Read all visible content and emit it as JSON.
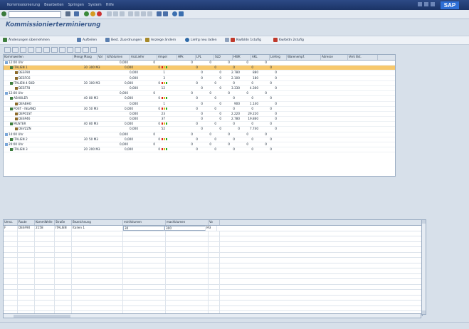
{
  "menu": [
    "Kommissionierung",
    "Bearbeiten",
    "Springen",
    "System",
    "Hilfe"
  ],
  "logo": "SAP",
  "title": "Kommissionierterminierung",
  "toolbar": [
    {
      "label": "Änderungen übernehmen",
      "color": "#3d7d3d"
    },
    {
      "label": "Aufteilen",
      "color": "#5a7fb0"
    },
    {
      "label": "Best. Zuordnungen",
      "color": "#5a7fb0"
    },
    {
      "label": "Anzeige ändern",
      "color": "#a78a2a"
    },
    {
      "label": "Liefrg neu laden",
      "color": "#2e6aa8"
    },
    {
      "label": "Kw/bldn 1stufig",
      "color": "#c0392b"
    },
    {
      "label": "Kw/bldn 2stufig",
      "color": "#c0392b"
    }
  ],
  "tree_columns": [
    "Kommiwellen",
    "Menge",
    "Maxg",
    "Vol",
    "IstVolumen",
    "AnzLiefer",
    "Ampel",
    "HPk",
    "LPL",
    "SLD",
    "HWK",
    "AKL",
    "Lieferg",
    "Warenempf.",
    "Adresse",
    "Verk Bst."
  ],
  "tree_rows": [
    {
      "level": 0,
      "type": "time",
      "name": "12:00 Uhr",
      "menge": "",
      "max": "",
      "vol": "",
      "istv": "0,000",
      "anzl": "0",
      "amp": false,
      "hpk": "0",
      "lpl": "0",
      "sld": "0",
      "hwk": "0",
      "akl": "0",
      "sel": false
    },
    {
      "level": 1,
      "type": "tour",
      "name": "ITALIEN 1",
      "menge": "30",
      "max": "300 M3",
      "vol": "",
      "istv": "0,000",
      "anzl": "0",
      "amp": true,
      "hpk": "0",
      "lpl": "0",
      "sld": "0",
      "hwk": "0",
      "akl": "0",
      "sel": true
    },
    {
      "level": 2,
      "type": "dest",
      "name": "DESF90",
      "menge": "",
      "max": "",
      "vol": "",
      "istv": "0,000",
      "anzl": "1",
      "amp": false,
      "hpk": "0",
      "lpl": "0",
      "sld": "2.780",
      "hwk": "880",
      "akl": "0",
      "sel": false
    },
    {
      "level": 2,
      "type": "dest",
      "name": "DESFC6",
      "menge": "",
      "max": "",
      "vol": "",
      "istv": "0,000",
      "anzl": "3",
      "amp": false,
      "hpk": "0",
      "lpl": "0",
      "sld": "2.100",
      "hwk": "180",
      "akl": "0",
      "sel": false
    },
    {
      "level": 1,
      "type": "tour",
      "name": "ITALIEN 4 SKD",
      "menge": "30",
      "max": "300 M3",
      "vol": "",
      "istv": "0,000",
      "anzl": "0",
      "amp": true,
      "hpk": "0",
      "lpl": "0",
      "sld": "0",
      "hwk": "0",
      "akl": "0",
      "sel": false
    },
    {
      "level": 2,
      "type": "dest",
      "name": "DESF78",
      "menge": "",
      "max": "",
      "vol": "",
      "istv": "0,000",
      "anzl": "12",
      "amp": false,
      "hpk": "0",
      "lpl": "0",
      "sld": "3.330",
      "hwk": "4.300",
      "akl": "0",
      "sel": false
    },
    {
      "level": 0,
      "type": "time",
      "name": "12:00 Uhr",
      "menge": "",
      "max": "",
      "vol": "",
      "istv": "0,000",
      "anzl": "0",
      "amp": false,
      "hpk": "0",
      "lpl": "0",
      "sld": "0",
      "hwk": "0",
      "akl": "0",
      "sel": false
    },
    {
      "level": 1,
      "type": "tour",
      "name": "ABHOLER",
      "menge": "40",
      "max": "80 M3",
      "vol": "",
      "istv": "0,000",
      "anzl": "0",
      "amp": true,
      "hpk": "0",
      "lpl": "0",
      "sld": "0",
      "hwk": "0",
      "akl": "0",
      "sel": false
    },
    {
      "level": 2,
      "type": "dest",
      "name": "DEABHO",
      "menge": "",
      "max": "",
      "vol": "",
      "istv": "0,000",
      "anzl": "1",
      "amp": false,
      "hpk": "0",
      "lpl": "0",
      "sld": "900",
      "hwk": "1.140",
      "akl": "0",
      "sel": false
    },
    {
      "level": 1,
      "type": "tour",
      "name": "POST - INLAND",
      "menge": "30",
      "max": "50 M3",
      "vol": "",
      "istv": "0,000",
      "anzl": "0",
      "amp": true,
      "hpk": "0",
      "lpl": "0",
      "sld": "0",
      "hwk": "0",
      "akl": "0",
      "sel": false
    },
    {
      "level": 2,
      "type": "dest",
      "name": "DEP01ST",
      "menge": "",
      "max": "",
      "vol": "",
      "istv": "0,000",
      "anzl": "23",
      "amp": false,
      "hpk": "0",
      "lpl": "0",
      "sld": "2.220",
      "hwk": "29.220",
      "akl": "0",
      "sel": false
    },
    {
      "level": 2,
      "type": "dest",
      "name": "DESP46",
      "menge": "",
      "max": "",
      "vol": "",
      "istv": "0,000",
      "anzl": "37",
      "amp": false,
      "hpk": "0",
      "lpl": "0",
      "sld": "2.780",
      "hwk": "19.860",
      "akl": "0",
      "sel": false
    },
    {
      "level": 1,
      "type": "tour",
      "name": "MUSTER",
      "menge": "40",
      "max": "80 M3",
      "vol": "",
      "istv": "0,000",
      "anzl": "0",
      "amp": true,
      "hpk": "0",
      "lpl": "0",
      "sld": "0",
      "hwk": "0",
      "akl": "0",
      "sel": false
    },
    {
      "level": 2,
      "type": "dest",
      "name": "DEVZZN",
      "menge": "",
      "max": "",
      "vol": "",
      "istv": "0,000",
      "anzl": "52",
      "amp": false,
      "hpk": "0",
      "lpl": "0",
      "sld": "0",
      "hwk": "7.740",
      "akl": "0",
      "sel": false
    },
    {
      "level": 0,
      "type": "time",
      "name": "14:00 Uhr",
      "menge": "",
      "max": "",
      "vol": "",
      "istv": "0,000",
      "anzl": "0",
      "amp": false,
      "hpk": "0",
      "lpl": "0",
      "sld": "0",
      "hwk": "0",
      "akl": "0",
      "sel": false
    },
    {
      "level": 1,
      "type": "tour",
      "name": "ITALIEN 2",
      "menge": "30",
      "max": "50 M3",
      "vol": "",
      "istv": "0,000",
      "anzl": "0",
      "amp": true,
      "hpk": "0",
      "lpl": "0",
      "sld": "0",
      "hwk": "0",
      "akl": "0",
      "sel": false
    },
    {
      "level": 0,
      "type": "time",
      "name": "20:00 Uhr",
      "menge": "",
      "max": "",
      "vol": "",
      "istv": "0,000",
      "anzl": "0",
      "amp": false,
      "hpk": "0",
      "lpl": "0",
      "sld": "0",
      "hwk": "0",
      "akl": "0",
      "sel": false
    },
    {
      "level": 1,
      "type": "tour",
      "name": "ITALIEN 3",
      "menge": "20",
      "max": "200 M3",
      "vol": "",
      "istv": "0,000",
      "anzl": "0",
      "amp": true,
      "hpk": "0",
      "lpl": "0",
      "sld": "0",
      "hwk": "0",
      "akl": "0",
      "sel": false
    }
  ],
  "detail_columns": [
    "Umsc.",
    "Route",
    "KommWelle",
    "Straße",
    "Bezeichnung",
    "minVolumen",
    "maxVolumen",
    "Vo"
  ],
  "detail_rows": [
    {
      "umsc": "F",
      "route": "DESF90",
      "welle": "2158",
      "strasse": "ITALIEN",
      "bez": "Italien 1",
      "minv": "30",
      "maxv": "300",
      "vo": "M3"
    }
  ],
  "colors": {
    "selected_row": "#f7c86c",
    "amp_red": "#d22",
    "amp_yellow": "#e0c020",
    "amp_green": "#2a2"
  }
}
